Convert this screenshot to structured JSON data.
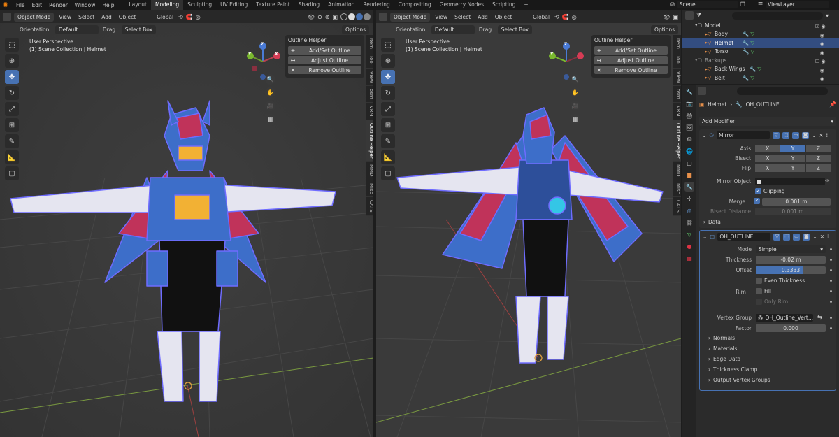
{
  "topbar": {
    "menus": [
      "File",
      "Edit",
      "Render",
      "Window",
      "Help"
    ],
    "workspaces": [
      "Layout",
      "Modeling",
      "Sculpting",
      "UV Editing",
      "Texture Paint",
      "Shading",
      "Animation",
      "Rendering",
      "Compositing",
      "Geometry Nodes",
      "Scripting"
    ],
    "active_workspace": "Modeling",
    "add_tab": "+",
    "scene": "Scene",
    "view_layer": "ViewLayer"
  },
  "viewport_left": {
    "mode": "Object Mode",
    "menus": [
      "View",
      "Select",
      "Add",
      "Object"
    ],
    "transform": "Global",
    "orientation_label": "Orientation:",
    "orientation_value": "Default",
    "drag_label": "Drag:",
    "drag_value": "Select Box",
    "options": "Options",
    "title": "User Perspective",
    "subtitle": "(1) Scene Collection | Helmet"
  },
  "viewport_right": {
    "mode": "Object Mode",
    "menus": [
      "View",
      "Select",
      "Add",
      "Object"
    ],
    "transform": "Global",
    "orientation_label": "Orientation:",
    "orientation_value": "Default",
    "drag_label": "Drag:",
    "drag_value": "Select Box",
    "options": "Options",
    "title": "User Perspective",
    "subtitle": "(1) Scene Collection | Helmet"
  },
  "outline_helper": {
    "title": "Outline Helper",
    "buttons": [
      "Add/Set Outline",
      "Adjust Outline",
      "Remove Outline"
    ]
  },
  "side_tabs": [
    "Item",
    "Tool",
    "View",
    "osm",
    "VRM",
    "Outline Helper",
    "MMD",
    "Misc",
    "CATS"
  ],
  "gizmo": {
    "x": "X",
    "y": "Y",
    "z": "Z"
  },
  "outliner": {
    "rows": [
      {
        "name": "Model",
        "indent": 0
      },
      {
        "name": "Body",
        "indent": 1
      },
      {
        "name": "Helmet",
        "indent": 1
      },
      {
        "name": "Torso",
        "indent": 1
      },
      {
        "name": "Backups",
        "indent": 0
      },
      {
        "name": "Back Wings",
        "indent": 1
      },
      {
        "name": "Belt",
        "indent": 1
      }
    ]
  },
  "properties": {
    "breadcrumb_object": "Helmet",
    "breadcrumb_modifier": "OH_OUTLINE",
    "add_modifier": "Add Modifier",
    "mirror": {
      "name": "Mirror",
      "axis_label": "Axis",
      "bisect_label": "Bisect",
      "flip_label": "Flip",
      "xyz": [
        "X",
        "Y",
        "Z"
      ],
      "mirror_object_label": "Mirror Object",
      "clipping_label": "Clipping",
      "merge_label": "Merge",
      "merge_value": "0.001 m",
      "bisect_distance_label": "Bisect Distance",
      "bisect_distance_value": "0.001 m",
      "data_label": "Data"
    },
    "outline": {
      "name": "OH_OUTLINE",
      "mode_label": "Mode",
      "mode_value": "Simple",
      "thickness_label": "Thickness",
      "thickness_value": "-0.02 m",
      "offset_label": "Offset",
      "offset_value": "0.3333",
      "even_thickness_label": "Even Thickness",
      "rim_label": "Rim",
      "fill_label": "Fill",
      "only_rim_label": "Only Rim",
      "vertex_group_label": "Vertex Group",
      "vertex_group_value": "OH_Outline_Vert...",
      "factor_label": "Factor",
      "factor_value": "0.000",
      "subpanels": [
        "Normals",
        "Materials",
        "Edge Data",
        "Thickness Clamp",
        "Output Vertex Groups"
      ]
    }
  },
  "colors": {
    "accent": "#4772b3",
    "bg": "#3b3b3b",
    "panel": "#303030"
  }
}
